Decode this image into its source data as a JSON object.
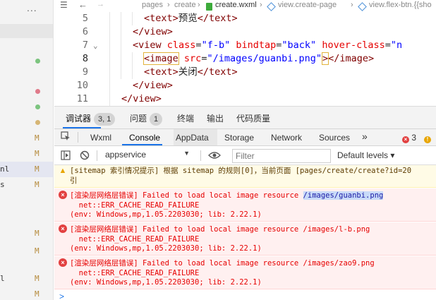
{
  "colors": {
    "accent": "#1a73e8",
    "error": "#e60000",
    "warning": "#e8a500",
    "tag": "#800000",
    "attr": "#e50000",
    "string": "#0000ff"
  },
  "file_tree": {
    "more_label": "...",
    "rows": [
      {
        "label": "",
        "marker": "",
        "dot_color": "#7cc47f"
      },
      {
        "label": "",
        "marker": "",
        "dot_color": "#e07a8a"
      },
      {
        "label": "",
        "marker": "",
        "dot_color": "#7cc47f"
      },
      {
        "label": "",
        "marker": "",
        "dot_color": "#d6b574"
      },
      {
        "label": "",
        "marker": "M",
        "dot_color": ""
      },
      {
        "label": "",
        "marker": "M",
        "dot_color": ""
      },
      {
        "label": "nl",
        "marker": "M",
        "dot_color": ""
      },
      {
        "label": "s",
        "marker": "M",
        "dot_color": ""
      },
      {
        "label": "",
        "marker": "M",
        "dot_color": ""
      },
      {
        "label": "",
        "marker": "M",
        "dot_color": ""
      },
      {
        "label": "l",
        "marker": "M",
        "dot_color": ""
      },
      {
        "label": "",
        "marker": "M",
        "dot_color": ""
      }
    ]
  },
  "breadcrumb": {
    "items": [
      "pages",
      "create",
      "create.wxml",
      "view.create-page",
      "view.flex-btn.{{sho"
    ]
  },
  "editor": {
    "lines": [
      {
        "num": "5"
      },
      {
        "num": "6"
      },
      {
        "num": "7"
      },
      {
        "num": "8"
      },
      {
        "num": "9"
      },
      {
        "num": "10"
      },
      {
        "num": "11"
      }
    ],
    "tokens": {
      "text_open": "<text>",
      "text_close": "</text>",
      "preview": "预览",
      "view_close": "</view>",
      "view_open": "<view",
      "class_attr": "class",
      "class_val": "\"f-b\"",
      "bindtap_attr": "bindtap",
      "bindtap_val": "\"back\"",
      "hover_attr": "hover-class",
      "hover_val": "\"n",
      "image_open": "<image",
      "src_attr": "src",
      "src_val": "\"/images/guanbi.png\"",
      "image_gt": ">",
      "image_close": "</image>",
      "close_label": "关闭",
      "eq": "="
    }
  },
  "panel_tabs": [
    {
      "label": "调试器",
      "badge": "3, 1"
    },
    {
      "label": "问题",
      "badge": "1"
    },
    {
      "label": "终端",
      "badge": ""
    },
    {
      "label": "输出",
      "badge": ""
    },
    {
      "label": "代码质量",
      "badge": ""
    }
  ],
  "devtools": {
    "tabs": [
      "Wxml",
      "Console",
      "AppData",
      "Storage",
      "Network",
      "Sources"
    ],
    "more": "»",
    "error_count": "3",
    "warn_count": "1"
  },
  "console_filter": {
    "context": "appservice",
    "filter_placeholder": "Filter",
    "levels": "Default levels"
  },
  "messages": {
    "warn": {
      "line1": "[sitemap 索引情况提示] 根据 sitemap 的规则[0]，当前页面 [pages/create/create?id=20",
      "line2": "引"
    },
    "errors": [
      {
        "prefix": "[渲染层网络层错误] Failed to load local image resource ",
        "path": "/images/guanbi.png",
        "line2": "  net::ERR_CACHE_READ_FAILURE",
        "line3": "(env: Windows,mp,1.05.2203030; lib: 2.22.1)"
      },
      {
        "prefix": "[渲染层网络层错误] Failed to load local image resource ",
        "path": "/images/l-b.png",
        "line2": "  net::ERR_CACHE_READ_FAILURE",
        "line3": "(env: Windows,mp,1.05.2203030; lib: 2.22.1)"
      },
      {
        "prefix": "[渲染层网络层错误] Failed to load local image resource ",
        "path": "/images/zao9.png",
        "line2": "  net::ERR_CACHE_READ_FAILURE",
        "line3": "(env: Windows,mp,1.05.2203030; lib: 2.22.1)"
      }
    ],
    "prompt": ">"
  }
}
